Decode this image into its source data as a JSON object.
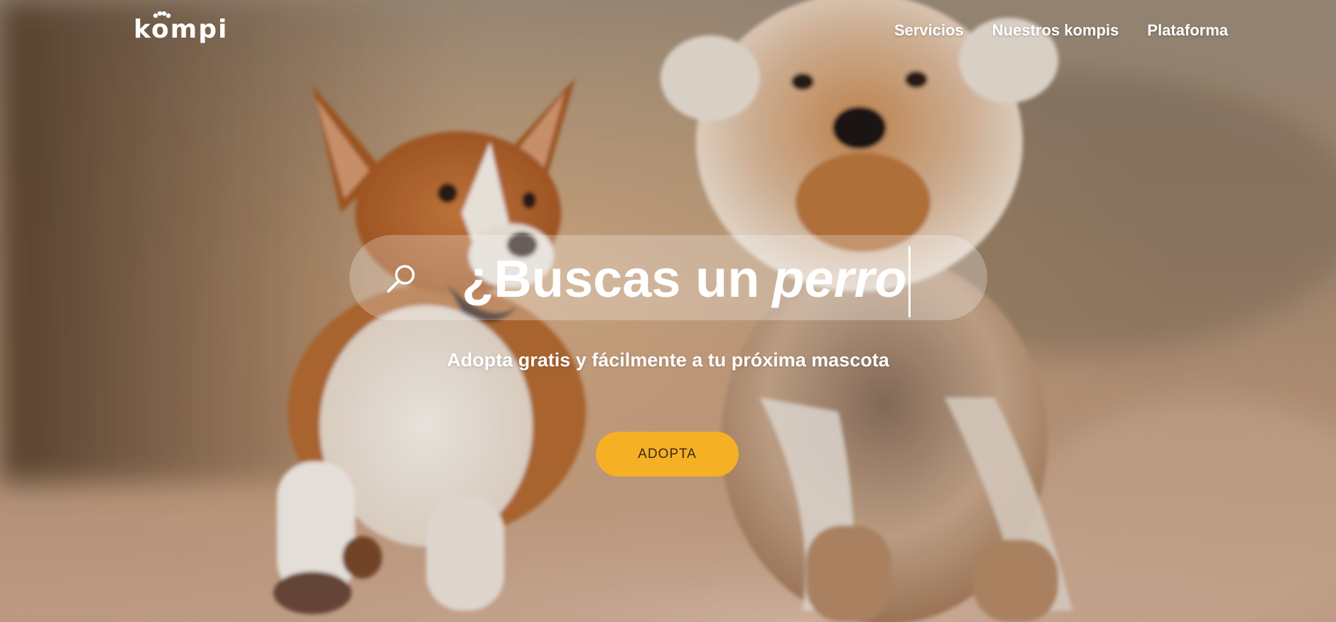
{
  "header": {
    "logo_text": "kompi",
    "nav": [
      {
        "label": "Servicios"
      },
      {
        "label": "Nuestros kompis"
      },
      {
        "label": "Plataforma"
      }
    ]
  },
  "hero": {
    "search_prefix": "¿Buscas un",
    "search_typed": "perro",
    "subtitle": "Adopta gratis y fácilmente a tu próxima mascota",
    "cta_label": "ADOPTA"
  },
  "colors": {
    "accent": "#f6b024",
    "text": "#ffffff",
    "cta_text": "#3a2a14"
  },
  "icons": {
    "search": "search-icon",
    "logo_paw": "paw-icon"
  }
}
